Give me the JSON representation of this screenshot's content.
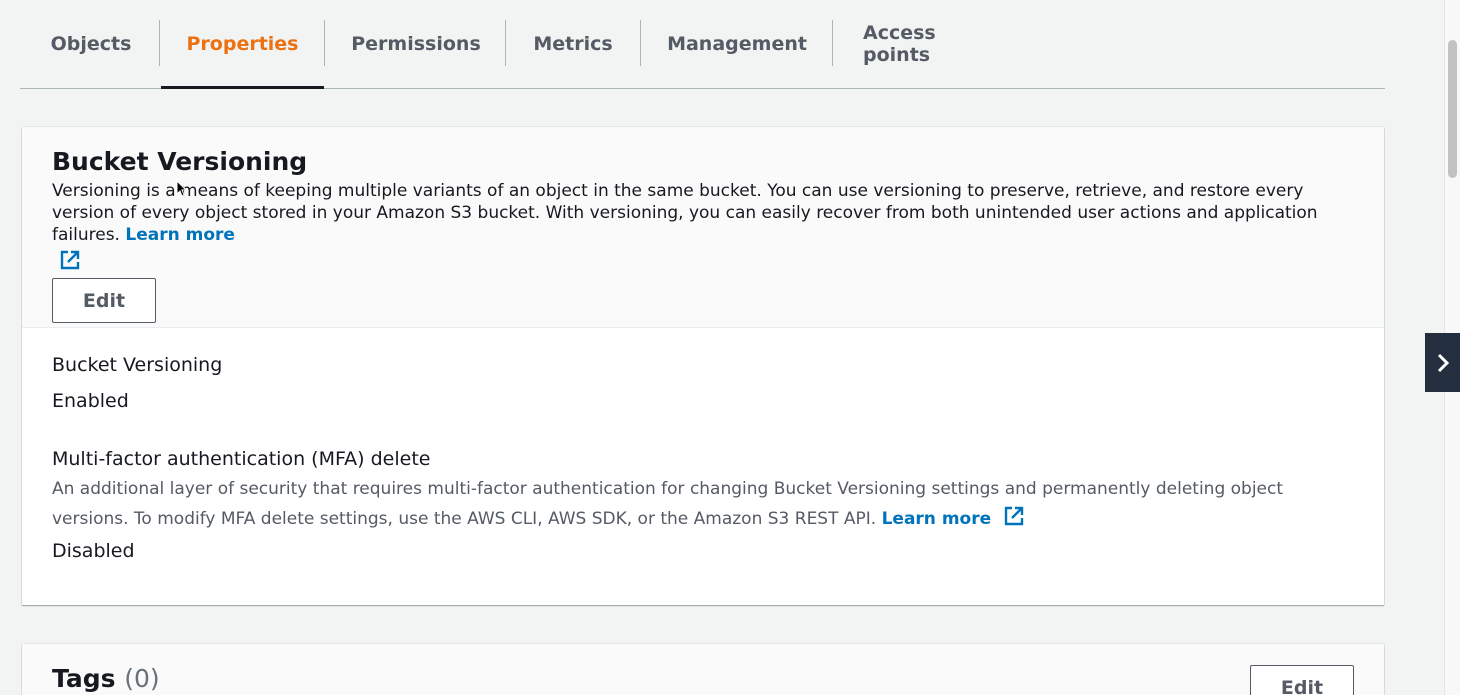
{
  "tabs": [
    {
      "label": "Objects",
      "active": false
    },
    {
      "label": "Properties",
      "active": true
    },
    {
      "label": "Permissions",
      "active": false
    },
    {
      "label": "Metrics",
      "active": false
    },
    {
      "label": "Management",
      "active": false
    },
    {
      "label": "Access points",
      "active": false
    }
  ],
  "versioning_panel": {
    "title": "Bucket Versioning",
    "description": "Versioning is a means of keeping multiple variants of an object in the same bucket. You can use versioning to preserve, retrieve, and restore every version of every object stored in your Amazon S3 bucket. With versioning, you can easily recover from both unintended user actions and application failures.",
    "learn_more": "Learn more",
    "edit_label": "Edit",
    "versioning_label": "Bucket Versioning",
    "versioning_value": "Enabled",
    "mfa_label": "Multi-factor authentication (MFA) delete",
    "mfa_description": "An additional layer of security that requires multi-factor authentication for changing Bucket Versioning settings and permanently deleting object versions. To modify MFA delete settings, use the AWS CLI, AWS SDK, or the Amazon S3 REST API.",
    "mfa_learn_more": "Learn more",
    "mfa_value": "Disabled"
  },
  "tags_panel": {
    "title": "Tags",
    "count": "(0)",
    "edit_label": "Edit"
  },
  "icons": {
    "external_link": "external-link-icon",
    "side_toggle": "chevron-right-icon"
  },
  "colors": {
    "active_tab": "#ec7211",
    "link": "#0073bb",
    "text": "#16191f",
    "side_toggle_bg": "#232f3e"
  }
}
